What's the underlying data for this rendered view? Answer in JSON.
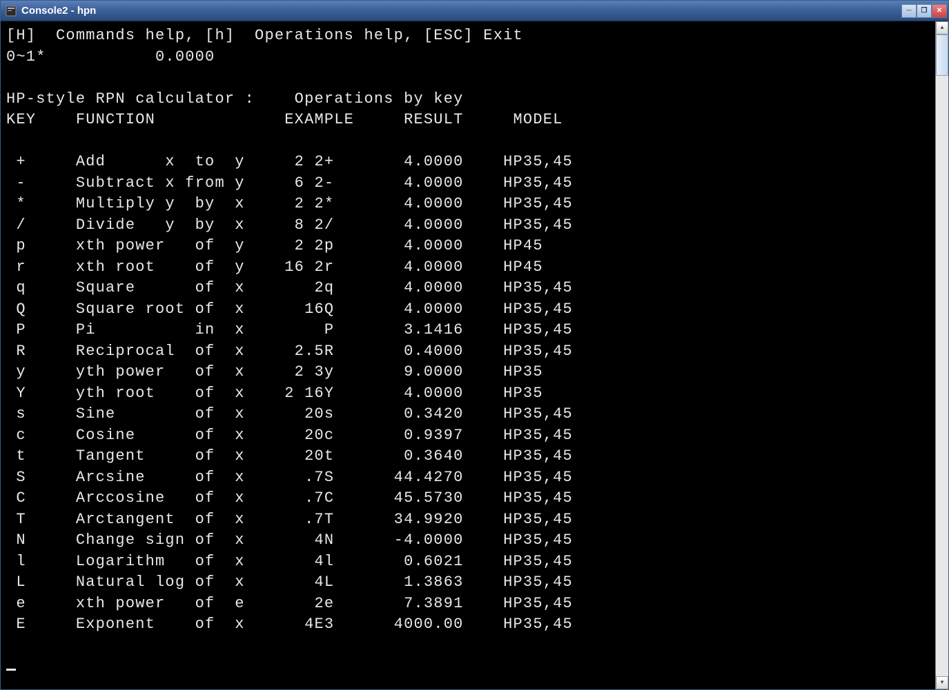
{
  "window": {
    "title": "Console2 - hpn"
  },
  "help_line": "[H]  Commands help, [h]  Operations help, [ESC] Exit",
  "stack_line": "0~1*           0.0000",
  "section_title": "HP-style RPN calculator :    Operations by key",
  "columns": {
    "c1": "KEY",
    "c2": "FUNCTION",
    "c3": "EXAMPLE",
    "c4": "RESULT",
    "c5": "MODEL"
  },
  "rows": [
    {
      "key": "+",
      "func": "Add      x  to  y",
      "ex": "2 2+",
      "res": "4.0000",
      "model": "HP35,45"
    },
    {
      "key": "-",
      "func": "Subtract x from y",
      "ex": "6 2-",
      "res": "4.0000",
      "model": "HP35,45"
    },
    {
      "key": "*",
      "func": "Multiply y  by  x",
      "ex": "2 2*",
      "res": "4.0000",
      "model": "HP35,45"
    },
    {
      "key": "/",
      "func": "Divide   y  by  x",
      "ex": "8 2/",
      "res": "4.0000",
      "model": "HP35,45"
    },
    {
      "key": "p",
      "func": "xth power   of  y",
      "ex": "2 2p",
      "res": "4.0000",
      "model": "HP45"
    },
    {
      "key": "r",
      "func": "xth root    of  y",
      "ex": "16 2r",
      "res": "4.0000",
      "model": "HP45"
    },
    {
      "key": "q",
      "func": "Square      of  x",
      "ex": "2q",
      "res": "4.0000",
      "model": "HP35,45"
    },
    {
      "key": "Q",
      "func": "Square root of  x",
      "ex": "16Q",
      "res": "4.0000",
      "model": "HP35,45"
    },
    {
      "key": "P",
      "func": "Pi          in  x",
      "ex": "P",
      "res": "3.1416",
      "model": "HP35,45"
    },
    {
      "key": "R",
      "func": "Reciprocal  of  x",
      "ex": "2.5R",
      "res": "0.4000",
      "model": "HP35,45"
    },
    {
      "key": "y",
      "func": "yth power   of  x",
      "ex": "2 3y",
      "res": "9.0000",
      "model": "HP35"
    },
    {
      "key": "Y",
      "func": "yth root    of  x",
      "ex": "2 16Y",
      "res": "4.0000",
      "model": "HP35"
    },
    {
      "key": "s",
      "func": "Sine        of  x",
      "ex": "20s",
      "res": "0.3420",
      "model": "HP35,45"
    },
    {
      "key": "c",
      "func": "Cosine      of  x",
      "ex": "20c",
      "res": "0.9397",
      "model": "HP35,45"
    },
    {
      "key": "t",
      "func": "Tangent     of  x",
      "ex": "20t",
      "res": "0.3640",
      "model": "HP35,45"
    },
    {
      "key": "S",
      "func": "Arcsine     of  x",
      "ex": ".7S",
      "res": "44.4270",
      "model": "HP35,45"
    },
    {
      "key": "C",
      "func": "Arccosine   of  x",
      "ex": ".7C",
      "res": "45.5730",
      "model": "HP35,45"
    },
    {
      "key": "T",
      "func": "Arctangent  of  x",
      "ex": ".7T",
      "res": "34.9920",
      "model": "HP35,45"
    },
    {
      "key": "N",
      "func": "Change sign of  x",
      "ex": "4N",
      "res": "-4.0000",
      "model": "HP35,45"
    },
    {
      "key": "l",
      "func": "Logarithm   of  x",
      "ex": "4l",
      "res": "0.6021",
      "model": "HP35,45"
    },
    {
      "key": "L",
      "func": "Natural log of  x",
      "ex": "4L",
      "res": "1.3863",
      "model": "HP35,45"
    },
    {
      "key": "e",
      "func": "xth power   of  e",
      "ex": "2e",
      "res": "7.3891",
      "model": "HP35,45"
    },
    {
      "key": "E",
      "func": "Exponent    of  x",
      "ex": "4E3",
      "res": "4000.00",
      "model": "HP35,45"
    }
  ]
}
